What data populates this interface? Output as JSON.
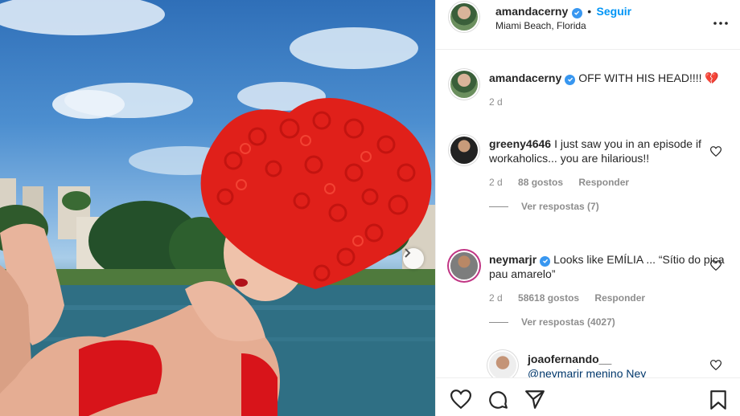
{
  "post": {
    "author": "amandacerny",
    "follow_label": "Seguir",
    "separator": "•",
    "location": "Miami Beach, Florida",
    "caption": "OFF WITH HIS HEAD!!!! 💔",
    "caption_age": "2 d"
  },
  "comments": [
    {
      "username": "greeny4646",
      "text": "I just saw you in an episode if workaholics... you are hilarious!!",
      "age": "2 d",
      "likes": "88 gostos",
      "reply_label": "Responder",
      "view_replies": "Ver respostas (7)"
    },
    {
      "username": "neymarjr",
      "text": "Looks like EMÍLIA ... “Sítio do pica pau amarelo”",
      "age": "2 d",
      "likes": "58618 gostos",
      "reply_label": "Responder",
      "view_replies": "Ver respostas (4027)"
    },
    {
      "username": "joaofernando__",
      "text": "@neymarjr menino Ney"
    }
  ],
  "icons": {
    "verified": "verified-badge-icon",
    "more": "more-options-icon",
    "like": "heart-icon",
    "comment": "comment-icon",
    "share": "share-icon",
    "save": "bookmark-icon",
    "next": "chevron-right-icon"
  },
  "colors": {
    "accent": "#0095f6",
    "verified": "#3897f0",
    "wig": "#e0201a",
    "bikini": "#d8141a"
  }
}
